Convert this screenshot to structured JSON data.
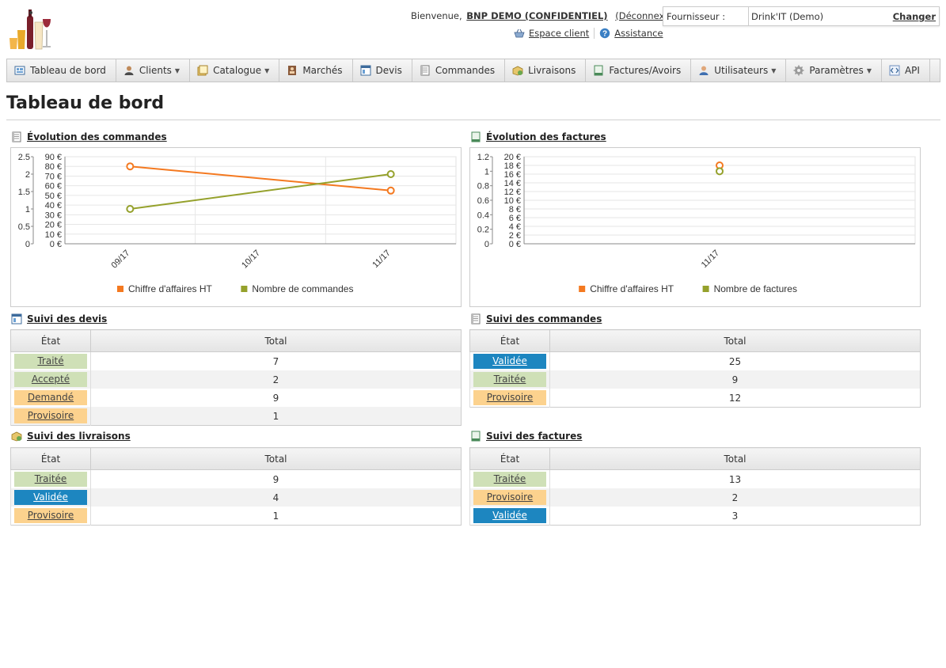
{
  "header": {
    "welcome_prefix": "Bienvenue,",
    "user_name": "BNP DEMO (CONFIDENTIEL)",
    "logout": "(Déconnexion)",
    "client_space": "Espace client",
    "assistance": "Assistance",
    "supplier_label": "Fournisseur :",
    "supplier_value": "Drink'IT (Demo)",
    "change": "Changer"
  },
  "menu": [
    {
      "label": "Tableau de bord",
      "icon": "dashboard-icon",
      "dropdown": false
    },
    {
      "label": "Clients",
      "icon": "client-person-icon",
      "dropdown": true
    },
    {
      "label": "Catalogue",
      "icon": "catalog-icon",
      "dropdown": true
    },
    {
      "label": "Marchés",
      "icon": "market-icon",
      "dropdown": false
    },
    {
      "label": "Devis",
      "icon": "quote-icon",
      "dropdown": false
    },
    {
      "label": "Commandes",
      "icon": "order-icon",
      "dropdown": false
    },
    {
      "label": "Livraisons",
      "icon": "delivery-box-icon",
      "dropdown": false
    },
    {
      "label": "Factures/Avoirs",
      "icon": "invoice-icon",
      "dropdown": false
    },
    {
      "label": "Utilisateurs",
      "icon": "users-icon",
      "dropdown": true
    },
    {
      "label": "Paramètres",
      "icon": "gear-icon",
      "dropdown": true
    },
    {
      "label": "API",
      "icon": "api-icon",
      "dropdown": false
    }
  ],
  "page_title": "Tableau de bord",
  "sections": {
    "orders_chart": "Évolution des commandes",
    "invoices_chart": "Évolution des factures",
    "quotes": "Suivi des devis",
    "orders": "Suivi des commandes",
    "deliveries": "Suivi des livraisons",
    "invoices": "Suivi des factures"
  },
  "table_headers": {
    "state": "État",
    "total": "Total"
  },
  "tables": {
    "quotes": [
      {
        "label": "Traité",
        "total": "7",
        "status": "green"
      },
      {
        "label": "Accepté",
        "total": "2",
        "status": "green"
      },
      {
        "label": "Demandé",
        "total": "9",
        "status": "orange"
      },
      {
        "label": "Provisoire",
        "total": "1",
        "status": "orange"
      }
    ],
    "orders": [
      {
        "label": "Validée",
        "total": "25",
        "status": "blue"
      },
      {
        "label": "Traitée",
        "total": "9",
        "status": "green"
      },
      {
        "label": "Provisoire",
        "total": "12",
        "status": "orange"
      }
    ],
    "deliveries": [
      {
        "label": "Traitée",
        "total": "9",
        "status": "green"
      },
      {
        "label": "Validée",
        "total": "4",
        "status": "blue"
      },
      {
        "label": "Provisoire",
        "total": "1",
        "status": "orange"
      }
    ],
    "invoices": [
      {
        "label": "Traitée",
        "total": "13",
        "status": "green"
      },
      {
        "label": "Provisoire",
        "total": "2",
        "status": "orange"
      },
      {
        "label": "Validée",
        "total": "3",
        "status": "blue"
      }
    ]
  },
  "status_colors": {
    "green": {
      "bg": "#cfe0b7",
      "fg": "#444444"
    },
    "orange": {
      "bg": "#fcd28e",
      "fg": "#444444"
    },
    "blue": {
      "bg": "#1d86c0",
      "fg": "#ffffff"
    }
  },
  "chart_data": [
    {
      "type": "line",
      "categories": [
        "09/17",
        "10/17",
        "11/17"
      ],
      "series": [
        {
          "name": "Chiffre d'affaires HT",
          "axis": "right",
          "color": "#f47920",
          "values": [
            80,
            null,
            55
          ]
        },
        {
          "name": "Nombre de commandes",
          "axis": "left",
          "color": "#95a12c",
          "values": [
            1,
            null,
            2
          ]
        }
      ],
      "y_left_ticks": [
        "0",
        "0.5",
        "1",
        "1.5",
        "2",
        "2.5"
      ],
      "y_left_range": [
        0,
        2.5
      ],
      "y_right_ticks": [
        "0 €",
        "10 €",
        "20 €",
        "30 €",
        "40 €",
        "50 €",
        "60 €",
        "70 €",
        "80 €",
        "90 €"
      ],
      "y_right_range": [
        0,
        90
      ],
      "legend_position": "bottom",
      "grid": true
    },
    {
      "type": "line",
      "categories": [
        "11/17"
      ],
      "series": [
        {
          "name": "Chiffre d'affaires HT",
          "axis": "right",
          "color": "#f47920",
          "values": [
            18
          ]
        },
        {
          "name": "Nombre de factures",
          "axis": "left",
          "color": "#95a12c",
          "values": [
            1
          ]
        }
      ],
      "y_left_ticks": [
        "0",
        "0.2",
        "0.4",
        "0.6",
        "0.8",
        "1",
        "1.2"
      ],
      "y_left_range": [
        0,
        1.2
      ],
      "y_right_ticks": [
        "0 €",
        "2 €",
        "4 €",
        "6 €",
        "8 €",
        "10 €",
        "12 €",
        "14 €",
        "16 €",
        "18 €",
        "20 €"
      ],
      "y_right_range": [
        0,
        20
      ],
      "legend_position": "bottom",
      "grid": true
    }
  ]
}
